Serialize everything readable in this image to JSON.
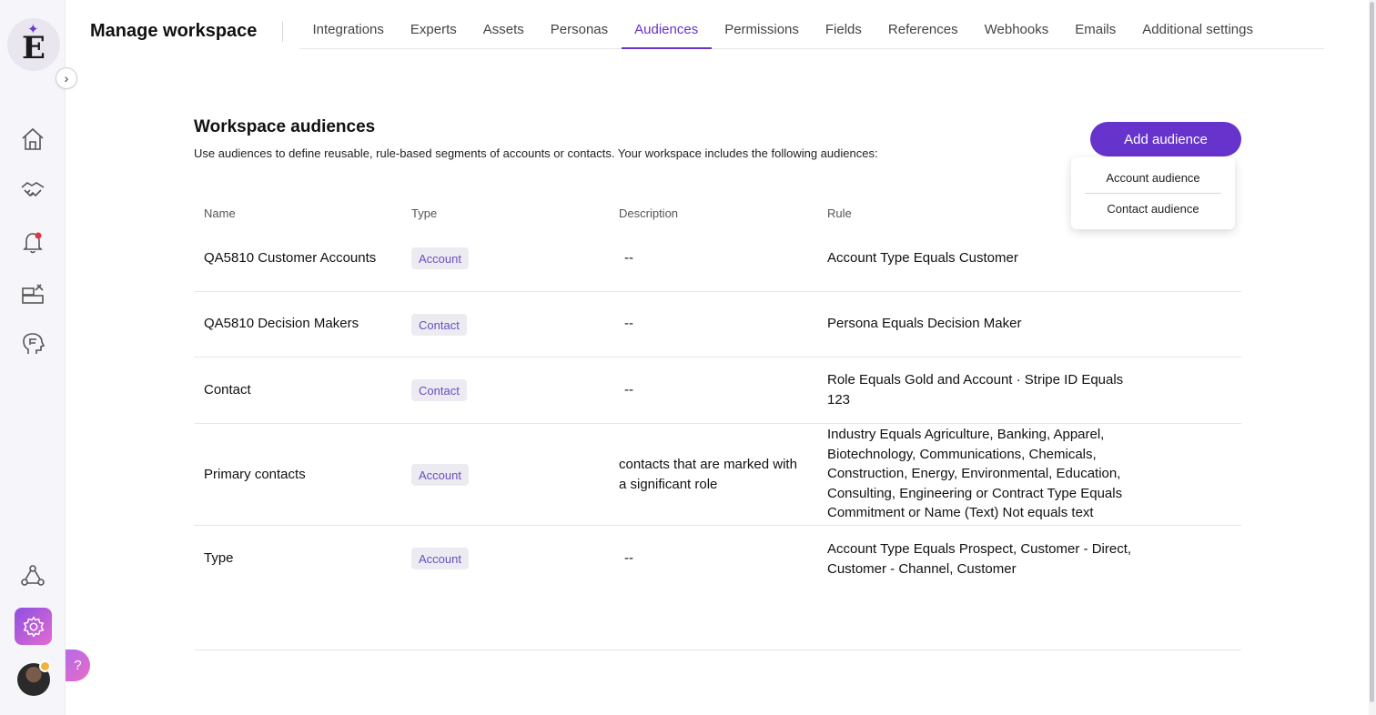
{
  "header": {
    "title": "Manage workspace",
    "tabs": [
      {
        "label": "Integrations"
      },
      {
        "label": "Experts"
      },
      {
        "label": "Assets"
      },
      {
        "label": "Personas"
      },
      {
        "label": "Audiences",
        "active": true
      },
      {
        "label": "Permissions"
      },
      {
        "label": "Fields"
      },
      {
        "label": "References"
      },
      {
        "label": "Webhooks"
      },
      {
        "label": "Emails"
      },
      {
        "label": "Additional settings"
      }
    ]
  },
  "sidebar": {
    "logo_letter": "E",
    "icons": [
      "home-icon",
      "handshake-icon",
      "bell-icon",
      "tools-icon",
      "brain-head-icon",
      "network-icon",
      "gear-icon"
    ],
    "help_label": "?"
  },
  "main": {
    "title": "Workspace audiences",
    "description": "Use audiences to define reusable, rule-based segments of accounts or contacts. Your workspace includes the following audiences:",
    "add_button": "Add audience",
    "dropdown": [
      "Account audience",
      "Contact audience"
    ],
    "columns": [
      "Name",
      "Type",
      "Description",
      "Rule"
    ],
    "rows": [
      {
        "name": "QA5810 Customer Accounts",
        "type": "Account",
        "description": "--",
        "rule": "Account Type Equals Customer"
      },
      {
        "name": "QA5810 Decision Makers",
        "type": "Contact",
        "description": "--",
        "rule": "Persona Equals Decision Maker"
      },
      {
        "name": "Contact",
        "type": "Contact",
        "description": "--",
        "rule": "Role Equals Gold and Account · Stripe ID Equals 123"
      },
      {
        "name": "Primary contacts",
        "type": "Account",
        "description": "contacts that are marked with a significant role",
        "rule": "Industry Equals Agriculture, Banking, Apparel, Biotechnology, Communications, Chemicals, Construction, Energy, Environmental, Education, Consulting, Engineering or Contract Type Equals Commitment or Name (Text) Not equals text"
      },
      {
        "name": "Type",
        "type": "Account",
        "description": "--",
        "rule": "Account Type Equals Prospect, Customer - Direct, Customer - Channel, Customer"
      }
    ]
  },
  "colors": {
    "accent": "#6633cc",
    "badge_bg": "#ecebf2",
    "badge_text": "#6a4fbf"
  }
}
